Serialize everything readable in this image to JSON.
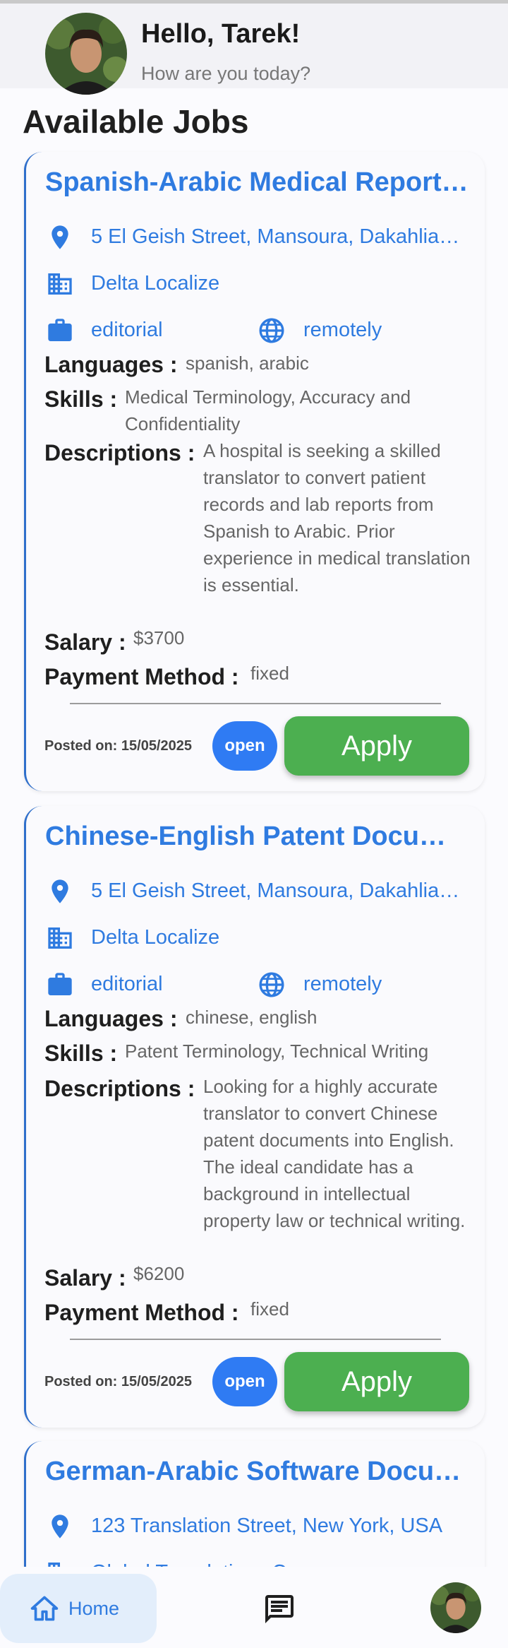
{
  "header": {
    "greeting": "Hello, Tarek!",
    "subtitle": "How are you today?"
  },
  "page_title": "Available Jobs",
  "jobs": [
    {
      "title": "Spanish-Arabic Medical Report …",
      "location": "5 El Geish Street, Mansoura, Dakahlia…",
      "company": "Delta Localize",
      "type": "editorial",
      "work_mode": "remotely",
      "languages_label": "Languages :",
      "languages": "spanish, arabic",
      "skills_label": "Skills :",
      "skills": "Medical Terminology, Accuracy and Confidentiality",
      "descriptions_label": "Descriptions :",
      "description": "A hospital is seeking a skilled translator to convert patient records and lab reports from Spanish to Arabic. Prior experience in medical translation is essential.",
      "salary_label": "Salary :",
      "salary": "$3700",
      "payment_label": "Payment Method :",
      "payment_method": "fixed",
      "posted": "Posted on: 15/05/2025",
      "status": "open",
      "apply_label": "Apply"
    },
    {
      "title": "Chinese-English Patent Docume…",
      "location": "5 El Geish Street, Mansoura, Dakahlia…",
      "company": "Delta Localize",
      "type": "editorial",
      "work_mode": "remotely",
      "languages_label": "Languages :",
      "languages": "chinese, english",
      "skills_label": "Skills :",
      "skills": "Patent Terminology, Technical Writing",
      "descriptions_label": "Descriptions :",
      "description": "Looking for a highly accurate translator to convert Chinese patent documents into English. The ideal candidate has a background in intellectual property law or technical writing.",
      "salary_label": "Salary :",
      "salary": "$6200",
      "payment_label": "Payment Method :",
      "payment_method": "fixed",
      "posted": "Posted on: 15/05/2025",
      "status": "open",
      "apply_label": "Apply"
    },
    {
      "title": "German-Arabic Software Docum…",
      "location": "123 Translation Street, New York, USA",
      "company": "Global Translations Co."
    }
  ],
  "bottom_nav": {
    "home_label": "Home",
    "home_icon": "home-icon",
    "chat_icon": "chat-icon",
    "profile_icon": "avatar"
  },
  "colors": {
    "accent": "#2F7BE0",
    "apply": "#4CAF50",
    "status_pill": "#2F7BF3"
  }
}
